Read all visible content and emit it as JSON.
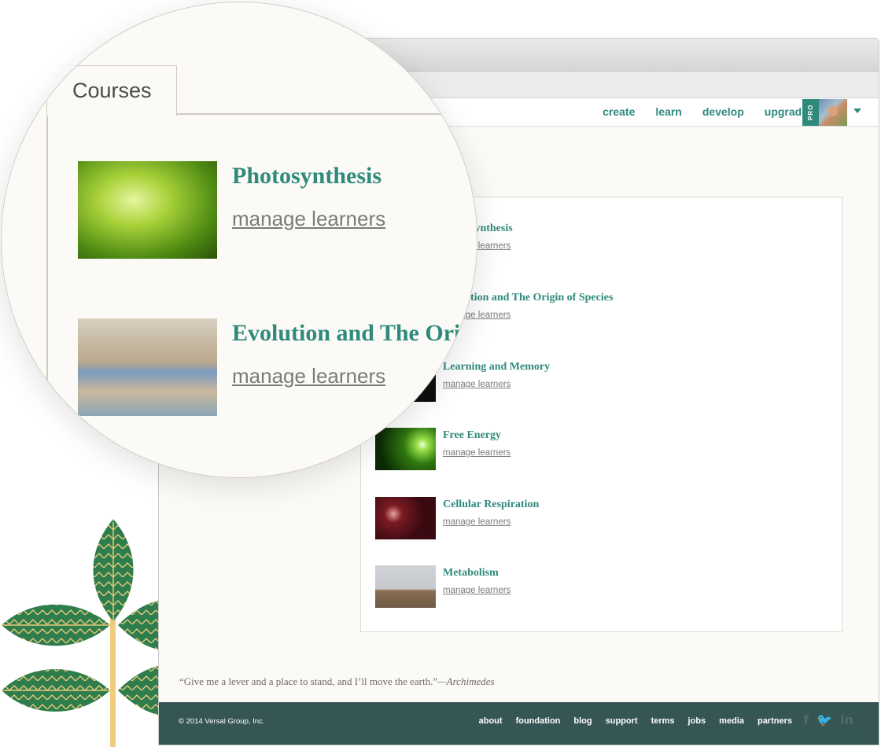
{
  "topnav": {
    "links": [
      "create",
      "learn",
      "develop",
      "upgrade"
    ],
    "pro_label": "PRO",
    "accent": "#2f8a7c"
  },
  "courses_tab": {
    "label": "Courses"
  },
  "courses": [
    {
      "title": "Photosynthesis",
      "link": "manage learners",
      "thumb": "green-leaves"
    },
    {
      "title": "Evolution and The Origin of Species",
      "link": "manage learners",
      "thumb": "finches-drinking"
    },
    {
      "title": "Learning and Memory",
      "link": "manage learners",
      "thumb": "dark-image"
    },
    {
      "title": "Free Energy",
      "link": "manage learners",
      "thumb": "glowing-green-bulb"
    },
    {
      "title": "Cellular Respiration",
      "link": "manage learners",
      "thumb": "red-bubbles"
    },
    {
      "title": "Metabolism",
      "link": "manage learners",
      "thumb": "bird-on-rock"
    }
  ],
  "quote": {
    "text": "“Give me a lever and a place to stand, and I’ll move the earth.”",
    "author": "—Archimedes"
  },
  "footer": {
    "copyright": "© 2014 Versal Group, Inc.",
    "links": [
      "about",
      "foundation",
      "blog",
      "support",
      "terms",
      "jobs",
      "media",
      "partners"
    ],
    "social": [
      "f",
      "🐦",
      "in"
    ],
    "color": "#365555"
  },
  "magnifier": {
    "tab_label": "Courses",
    "items": [
      {
        "title": "Photosynthesis",
        "link": "manage learners"
      },
      {
        "title": "Evolution and The Origin of Species",
        "link": "manage learners"
      }
    ]
  }
}
